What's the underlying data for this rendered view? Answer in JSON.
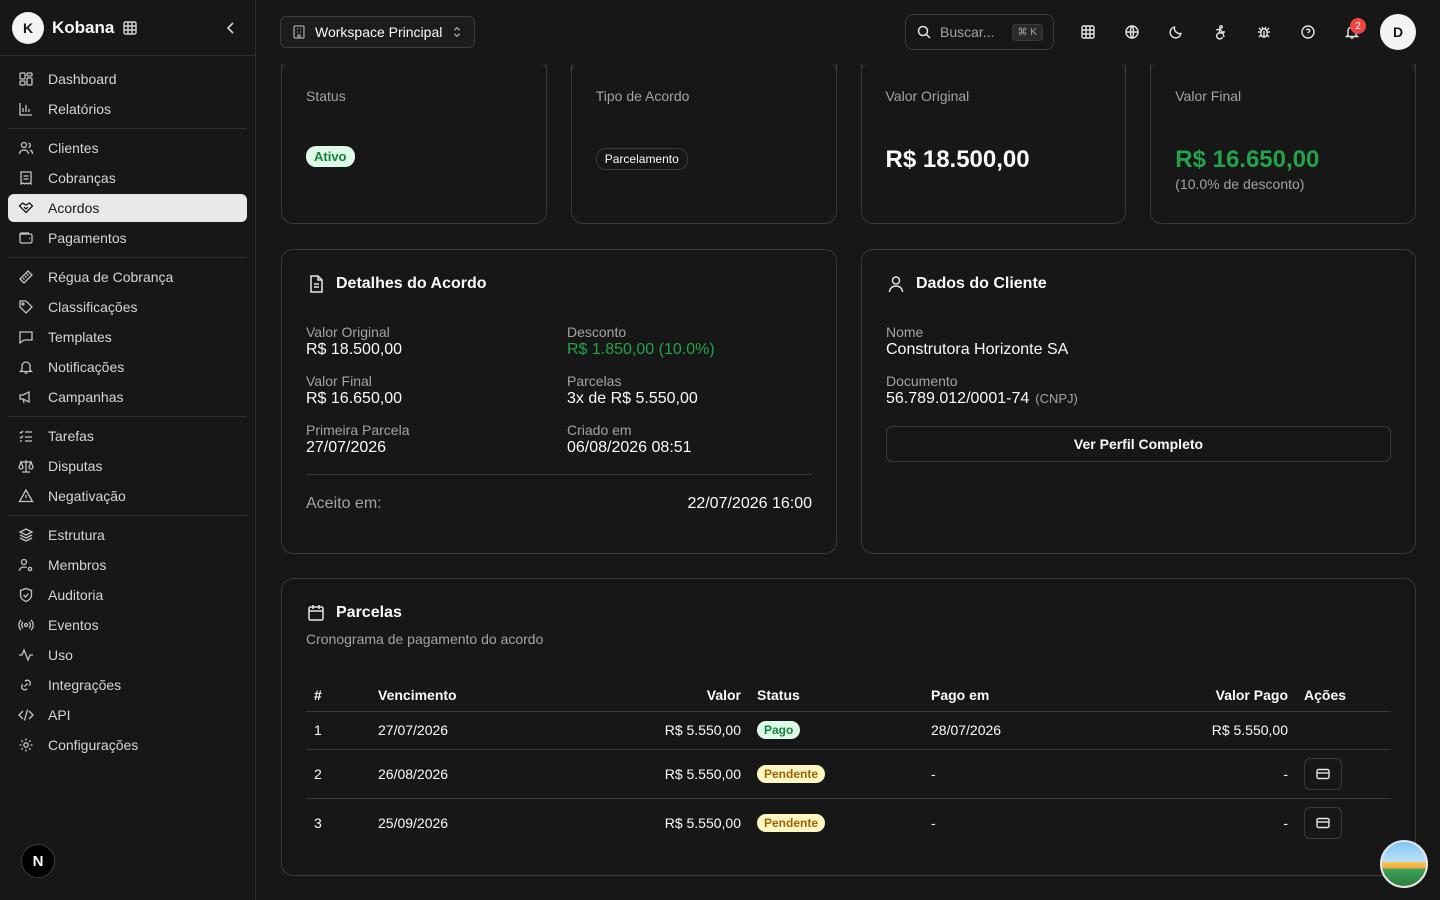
{
  "app": {
    "logo_letter": "K",
    "brand": "Kobana"
  },
  "sidebar": {
    "groups": [
      [
        {
          "label": "Dashboard",
          "icon": "dashboard-icon"
        },
        {
          "label": "Relatórios",
          "icon": "bar-chart-icon"
        }
      ],
      [
        {
          "label": "Clientes",
          "icon": "users-icon"
        },
        {
          "label": "Cobranças",
          "icon": "receipt-icon"
        },
        {
          "label": "Acordos",
          "icon": "handshake-icon",
          "active": true
        },
        {
          "label": "Pagamentos",
          "icon": "wallet-icon"
        }
      ],
      [
        {
          "label": "Régua de Cobrança",
          "icon": "ruler-icon"
        },
        {
          "label": "Classificações",
          "icon": "tag-icon"
        },
        {
          "label": "Templates",
          "icon": "message-square-icon"
        },
        {
          "label": "Notificações",
          "icon": "bell-icon"
        },
        {
          "label": "Campanhas",
          "icon": "megaphone-icon"
        }
      ],
      [
        {
          "label": "Tarefas",
          "icon": "list-checks-icon"
        },
        {
          "label": "Disputas",
          "icon": "scale-icon"
        },
        {
          "label": "Negativação",
          "icon": "alert-triangle-icon"
        }
      ],
      [
        {
          "label": "Estrutura",
          "icon": "layers-icon"
        },
        {
          "label": "Membros",
          "icon": "users-cog-icon"
        },
        {
          "label": "Auditoria",
          "icon": "shield-check-icon"
        },
        {
          "label": "Eventos",
          "icon": "radio-icon"
        },
        {
          "label": "Uso",
          "icon": "activity-icon"
        },
        {
          "label": "Integrações",
          "icon": "link-icon"
        },
        {
          "label": "API",
          "icon": "code-icon"
        },
        {
          "label": "Configurações",
          "icon": "settings-icon"
        }
      ]
    ],
    "footer_avatar": "N"
  },
  "topbar": {
    "workspace": "Workspace Principal",
    "search_placeholder": "Buscar...",
    "search_shortcut": "⌘ K",
    "notification_count": "2",
    "user_initial": "D"
  },
  "stats": {
    "status": {
      "label": "Status",
      "value": "Ativo"
    },
    "tipo": {
      "label": "Tipo de Acordo",
      "value": "Parcelamento"
    },
    "valor_original": {
      "label": "Valor Original",
      "value": "R$ 18.500,00"
    },
    "valor_final": {
      "label": "Valor Final",
      "value": "R$ 16.650,00",
      "sub": "(10.0% de desconto)"
    }
  },
  "detalhes": {
    "title": "Detalhes do Acordo",
    "valor_original_label": "Valor Original",
    "valor_original": "R$ 18.500,00",
    "desconto_label": "Desconto",
    "desconto": "R$ 1.850,00 (10.0%)",
    "valor_final_label": "Valor Final",
    "valor_final": "R$ 16.650,00",
    "parcelas_label": "Parcelas",
    "parcelas": "3x de R$ 5.550,00",
    "primeira_label": "Primeira Parcela",
    "primeira": "27/07/2026",
    "criado_label": "Criado em",
    "criado": "06/08/2026 08:51",
    "aceito_label": "Aceito em:",
    "aceito": "22/07/2026 16:00"
  },
  "cliente": {
    "title": "Dados do Cliente",
    "nome_label": "Nome",
    "nome": "Construtora Horizonte SA",
    "doc_label": "Documento",
    "doc": "56.789.012/0001-74",
    "doc_type": "(CNPJ)",
    "button": "Ver Perfil Completo"
  },
  "parcelas": {
    "title": "Parcelas",
    "description": "Cronograma de pagamento do acordo",
    "columns": {
      "num": "#",
      "vencimento": "Vencimento",
      "valor": "Valor",
      "status": "Status",
      "pago_em": "Pago em",
      "valor_pago": "Valor Pago",
      "acoes": "Ações"
    },
    "rows": [
      {
        "num": "1",
        "vencimento": "27/07/2026",
        "valor": "R$ 5.550,00",
        "status": "Pago",
        "pago_em": "28/07/2026",
        "valor_pago": "R$ 5.550,00"
      },
      {
        "num": "2",
        "vencimento": "26/08/2026",
        "valor": "R$ 5.550,00",
        "status": "Pendente",
        "pago_em": "-",
        "valor_pago": "-"
      },
      {
        "num": "3",
        "vencimento": "25/09/2026",
        "valor": "R$ 5.550,00",
        "status": "Pendente",
        "pago_em": "-",
        "valor_pago": "-"
      }
    ]
  },
  "colors": {
    "accent_green": "#22a34a",
    "badge_paid_bg": "#dcfce7",
    "badge_pending_bg": "#fef9c3",
    "notification_red": "#ef4444"
  }
}
